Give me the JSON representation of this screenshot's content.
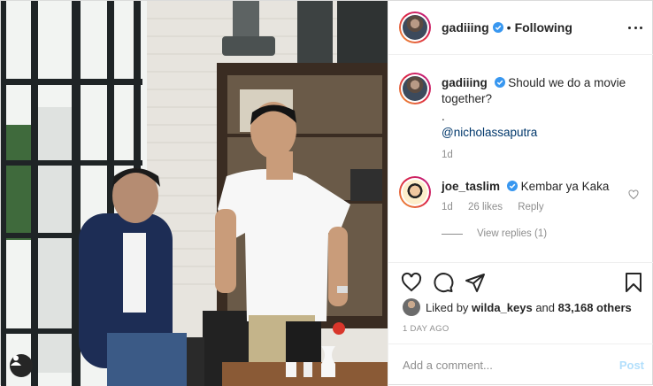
{
  "post": {
    "author": "gadiiing",
    "follow_status": "Following",
    "dot": "•"
  },
  "comments": [
    {
      "username": "gadiiing",
      "text": "Should we do a movie together?",
      "extra_line": ".",
      "mention": "@nicholassaputra",
      "age": "1d"
    },
    {
      "username": "joe_taslim",
      "text": "Kembar ya Kaka",
      "age": "1d",
      "likes": "26 likes",
      "reply_label": "Reply",
      "view_replies": "View replies (1)"
    }
  ],
  "likes": {
    "prefix": "Liked by",
    "user": "wilda_keys",
    "and": "and",
    "others": "83,168 others"
  },
  "timestamp": "1 DAY AGO",
  "add_comment": {
    "placeholder": "Add a comment...",
    "post_label": "Post"
  },
  "colors": {
    "verified": "#3897f0",
    "link": "#00376b",
    "post_disabled": "#b2dffc"
  },
  "icons": [
    "user-tag-icon",
    "more-options-icon",
    "verified-icon",
    "heart-icon",
    "comment-icon",
    "share-icon",
    "bookmark-icon"
  ]
}
